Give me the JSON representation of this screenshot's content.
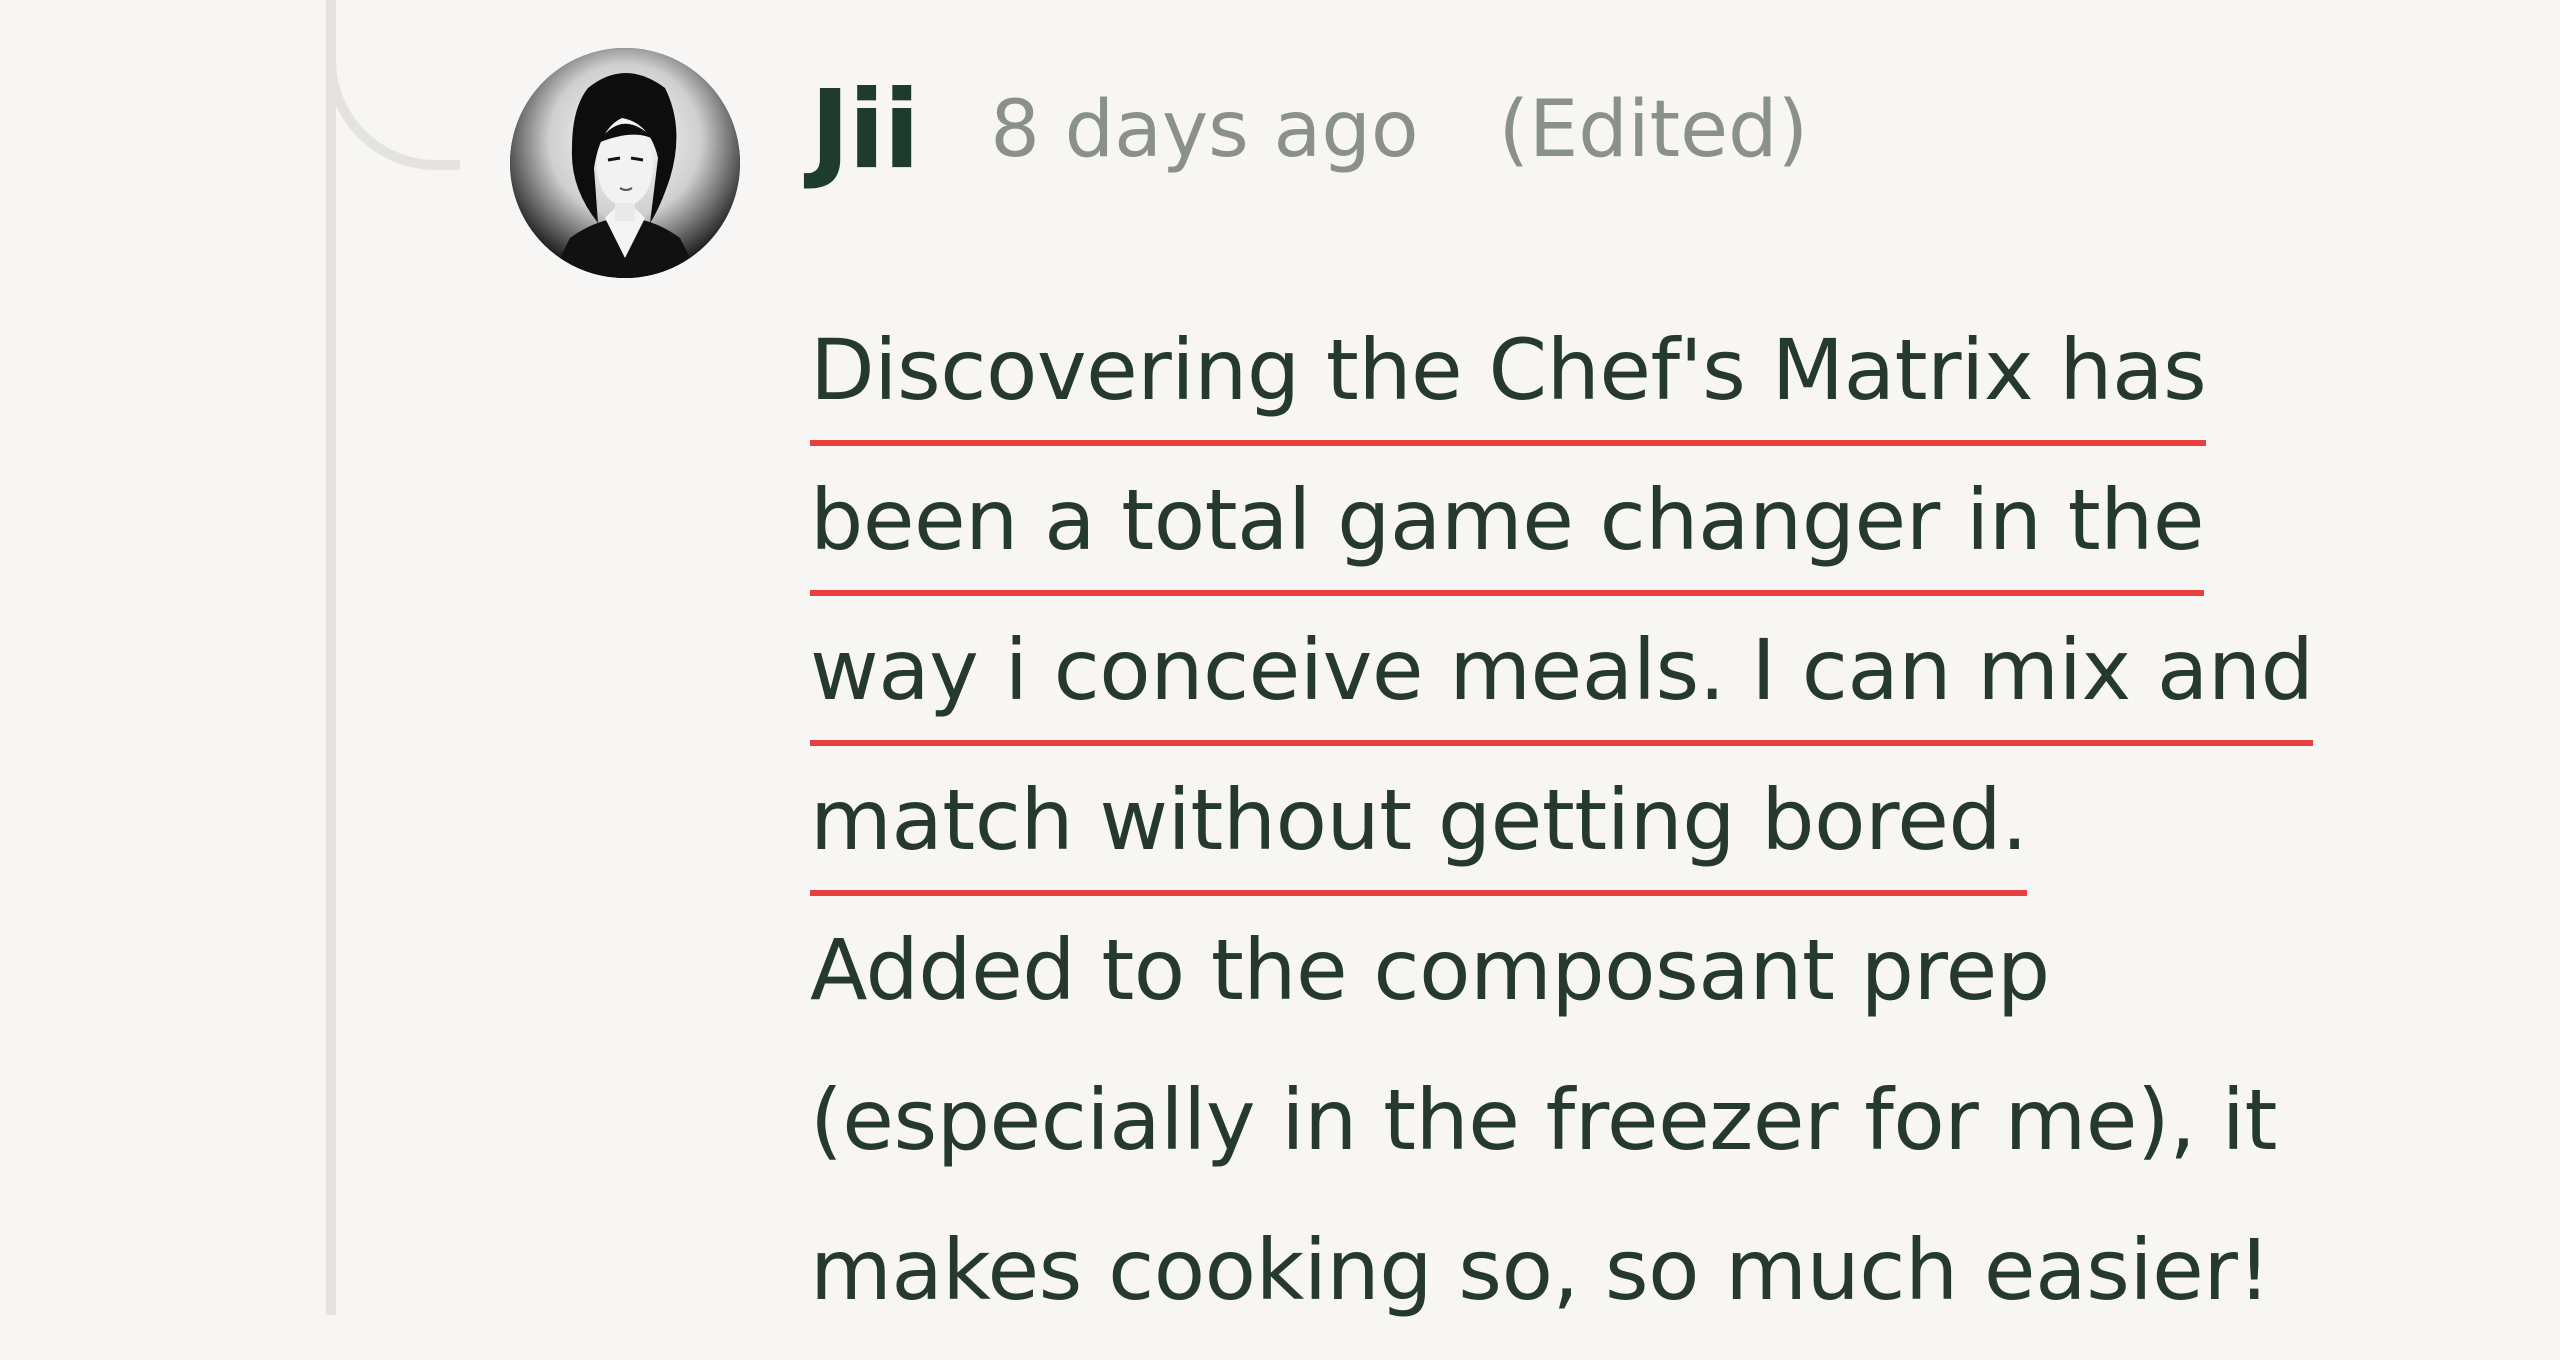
{
  "comment": {
    "author": "Jii",
    "timestamp": "8 days ago",
    "edited": "(Edited)",
    "lines": [
      "Discovering the Chef's Matrix has",
      "been a total game changer in the",
      "way i conceive meals. I can mix and",
      "match without getting bored.",
      "Added to the composant prep",
      "(especially in the freezer for me), it",
      "makes cooking so, so much easier!"
    ],
    "underline_color": "#e84040"
  },
  "colors": {
    "background": "#f7f6f4",
    "thread_line": "#e4e3e0",
    "author_text": "#1f3a2e",
    "meta_text": "#8a9189",
    "body_text": "#253a2d"
  },
  "icons": {
    "avatar": "user-avatar-illustration"
  }
}
